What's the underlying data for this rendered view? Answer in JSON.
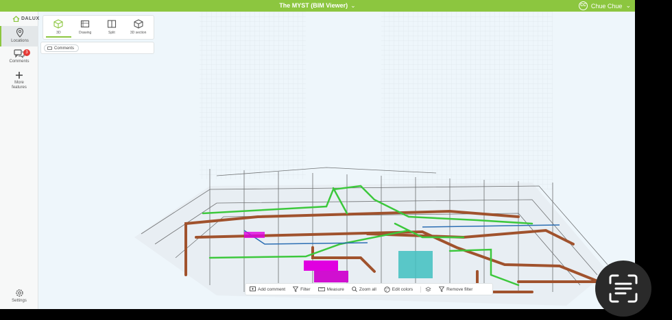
{
  "header": {
    "title": "The MYST (BIM Viewer)",
    "user_initials": "CC",
    "user_name": "Chue Chue",
    "accent": "#8cc63f"
  },
  "sidebar": {
    "logo": "DALUX",
    "items": [
      {
        "label": "Locations",
        "icon": "location-pin-icon"
      },
      {
        "label": "Comments",
        "icon": "chat-bubbles-icon",
        "badge": "3"
      },
      {
        "label": "More features",
        "icon": "plus-icon"
      }
    ],
    "settings": {
      "label": "Settings",
      "icon": "gear-icon"
    }
  },
  "view_modes": [
    {
      "label": "3D",
      "icon": "cube-icon"
    },
    {
      "label": "Drawing",
      "icon": "drawing-icon"
    },
    {
      "label": "Split",
      "icon": "split-icon"
    },
    {
      "label": "3D section",
      "icon": "section-box-icon"
    }
  ],
  "comments_panel": {
    "chip_label": "Comments"
  },
  "toolbar": {
    "add_comment": "Add comment",
    "filter": "Filter",
    "measure": "Measure",
    "zoom_all": "Zoom all",
    "edit_colors": "Edit colors",
    "remove_filter": "Remove filter"
  },
  "model_colors": {
    "duct": "#a0522d",
    "pipe": "#3cc83c",
    "equipment": "#e000e0",
    "water": "#40c0c0"
  }
}
